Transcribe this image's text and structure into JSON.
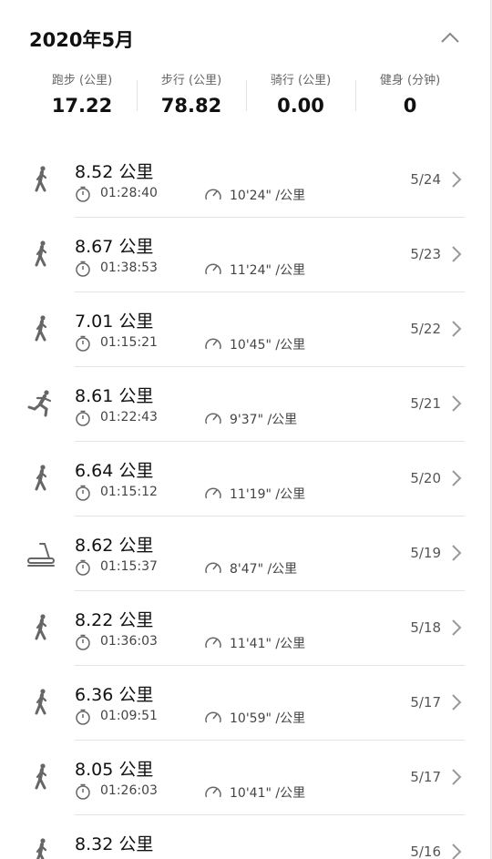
{
  "month_title": "2020年5月",
  "summary": [
    {
      "label": "跑步 (公里)",
      "value": "17.22"
    },
    {
      "label": "步行 (公里)",
      "value": "78.82"
    },
    {
      "label": "骑行 (公里)",
      "value": "0.00"
    },
    {
      "label": "健身 (分钟)",
      "value": "0"
    }
  ],
  "activities": [
    {
      "type": "walk-icon",
      "distance": "8.52 公里",
      "duration": "01:28:40",
      "pace": "10'24\" /公里",
      "date": "5/24"
    },
    {
      "type": "walk-icon",
      "distance": "8.67 公里",
      "duration": "01:38:53",
      "pace": "11'24\" /公里",
      "date": "5/23"
    },
    {
      "type": "walk-icon",
      "distance": "7.01 公里",
      "duration": "01:15:21",
      "pace": "10'45\" /公里",
      "date": "5/22"
    },
    {
      "type": "run-icon",
      "distance": "8.61 公里",
      "duration": "01:22:43",
      "pace": "9'37\" /公里",
      "date": "5/21"
    },
    {
      "type": "walk-icon",
      "distance": "6.64 公里",
      "duration": "01:15:12",
      "pace": "11'19\" /公里",
      "date": "5/20"
    },
    {
      "type": "treadmill-icon",
      "distance": "8.62 公里",
      "duration": "01:15:37",
      "pace": "8'47\" /公里",
      "date": "5/19"
    },
    {
      "type": "walk-icon",
      "distance": "8.22 公里",
      "duration": "01:36:03",
      "pace": "11'41\" /公里",
      "date": "5/18"
    },
    {
      "type": "walk-icon",
      "distance": "6.36 公里",
      "duration": "01:09:51",
      "pace": "10'59\" /公里",
      "date": "5/17"
    },
    {
      "type": "walk-icon",
      "distance": "8.05 公里",
      "duration": "01:26:03",
      "pace": "10'41\" /公里",
      "date": "5/17"
    },
    {
      "type": "walk-icon",
      "distance": "8.32 公里",
      "duration": "",
      "pace": "",
      "date": "5/16"
    }
  ],
  "colors": {
    "background": "#ffffff",
    "page": "#f0f0f0",
    "text": "#111111",
    "muted": "#666666",
    "divider": "#e4e4e4"
  }
}
